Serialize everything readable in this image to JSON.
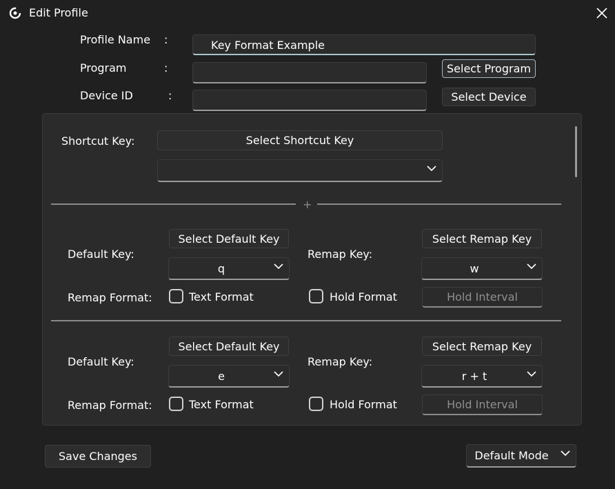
{
  "window": {
    "title": "Edit Profile"
  },
  "profile": {
    "name_label": "Profile Name",
    "name_value": "Key Format Example",
    "program_label": "Program",
    "program_value": "",
    "device_label": "Device ID",
    "device_value": "",
    "colon": ":",
    "select_program": "Select Program",
    "select_device": "Select Device"
  },
  "shortcut": {
    "label": "Shortcut Key:",
    "button": "Select Shortcut Key",
    "value": ""
  },
  "divider_plus": "+",
  "mappings": [
    {
      "default_label": "Default Key:",
      "select_default": "Select Default Key",
      "default_value": "q",
      "remap_label": "Remap Key:",
      "select_remap": "Select Remap Key",
      "remap_value": "w",
      "format_label": "Remap Format:",
      "text_format": "Text Format",
      "hold_format": "Hold Format",
      "hold_interval": "Hold Interval"
    },
    {
      "default_label": "Default Key:",
      "select_default": "Select Default Key",
      "default_value": "e",
      "remap_label": "Remap Key:",
      "select_remap": "Select Remap Key",
      "remap_value": "r + t",
      "format_label": "Remap Format:",
      "text_format": "Text Format",
      "hold_format": "Hold Format",
      "hold_interval": "Hold Interval"
    }
  ],
  "footer": {
    "save": "Save Changes",
    "mode": "Default Mode"
  }
}
